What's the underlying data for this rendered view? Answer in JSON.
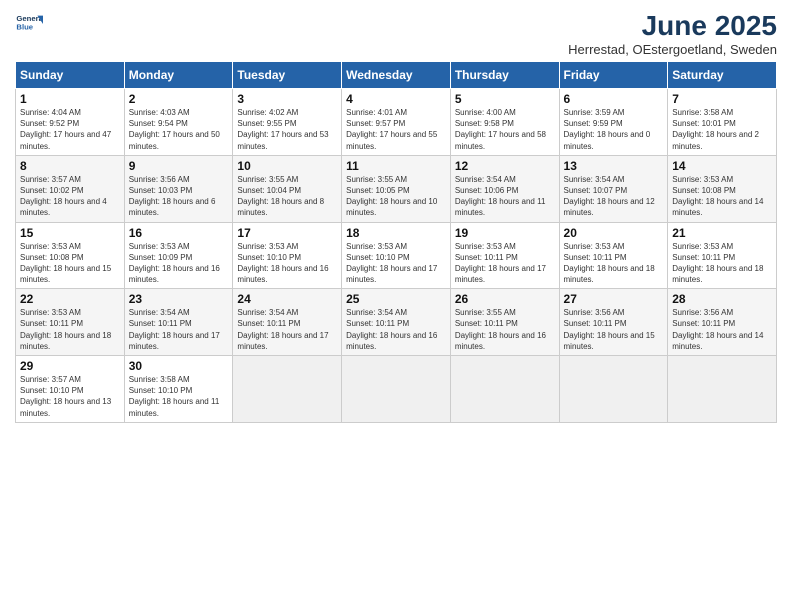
{
  "header": {
    "logo_line1": "General",
    "logo_line2": "Blue",
    "title": "June 2025",
    "subtitle": "Herrestad, OEstergoetland, Sweden"
  },
  "weekdays": [
    "Sunday",
    "Monday",
    "Tuesday",
    "Wednesday",
    "Thursday",
    "Friday",
    "Saturday"
  ],
  "weeks": [
    [
      {
        "day": "1",
        "sunrise": "Sunrise: 4:04 AM",
        "sunset": "Sunset: 9:52 PM",
        "daylight": "Daylight: 17 hours and 47 minutes."
      },
      {
        "day": "2",
        "sunrise": "Sunrise: 4:03 AM",
        "sunset": "Sunset: 9:54 PM",
        "daylight": "Daylight: 17 hours and 50 minutes."
      },
      {
        "day": "3",
        "sunrise": "Sunrise: 4:02 AM",
        "sunset": "Sunset: 9:55 PM",
        "daylight": "Daylight: 17 hours and 53 minutes."
      },
      {
        "day": "4",
        "sunrise": "Sunrise: 4:01 AM",
        "sunset": "Sunset: 9:57 PM",
        "daylight": "Daylight: 17 hours and 55 minutes."
      },
      {
        "day": "5",
        "sunrise": "Sunrise: 4:00 AM",
        "sunset": "Sunset: 9:58 PM",
        "daylight": "Daylight: 17 hours and 58 minutes."
      },
      {
        "day": "6",
        "sunrise": "Sunrise: 3:59 AM",
        "sunset": "Sunset: 9:59 PM",
        "daylight": "Daylight: 18 hours and 0 minutes."
      },
      {
        "day": "7",
        "sunrise": "Sunrise: 3:58 AM",
        "sunset": "Sunset: 10:01 PM",
        "daylight": "Daylight: 18 hours and 2 minutes."
      }
    ],
    [
      {
        "day": "8",
        "sunrise": "Sunrise: 3:57 AM",
        "sunset": "Sunset: 10:02 PM",
        "daylight": "Daylight: 18 hours and 4 minutes."
      },
      {
        "day": "9",
        "sunrise": "Sunrise: 3:56 AM",
        "sunset": "Sunset: 10:03 PM",
        "daylight": "Daylight: 18 hours and 6 minutes."
      },
      {
        "day": "10",
        "sunrise": "Sunrise: 3:55 AM",
        "sunset": "Sunset: 10:04 PM",
        "daylight": "Daylight: 18 hours and 8 minutes."
      },
      {
        "day": "11",
        "sunrise": "Sunrise: 3:55 AM",
        "sunset": "Sunset: 10:05 PM",
        "daylight": "Daylight: 18 hours and 10 minutes."
      },
      {
        "day": "12",
        "sunrise": "Sunrise: 3:54 AM",
        "sunset": "Sunset: 10:06 PM",
        "daylight": "Daylight: 18 hours and 11 minutes."
      },
      {
        "day": "13",
        "sunrise": "Sunrise: 3:54 AM",
        "sunset": "Sunset: 10:07 PM",
        "daylight": "Daylight: 18 hours and 12 minutes."
      },
      {
        "day": "14",
        "sunrise": "Sunrise: 3:53 AM",
        "sunset": "Sunset: 10:08 PM",
        "daylight": "Daylight: 18 hours and 14 minutes."
      }
    ],
    [
      {
        "day": "15",
        "sunrise": "Sunrise: 3:53 AM",
        "sunset": "Sunset: 10:08 PM",
        "daylight": "Daylight: 18 hours and 15 minutes."
      },
      {
        "day": "16",
        "sunrise": "Sunrise: 3:53 AM",
        "sunset": "Sunset: 10:09 PM",
        "daylight": "Daylight: 18 hours and 16 minutes."
      },
      {
        "day": "17",
        "sunrise": "Sunrise: 3:53 AM",
        "sunset": "Sunset: 10:10 PM",
        "daylight": "Daylight: 18 hours and 16 minutes."
      },
      {
        "day": "18",
        "sunrise": "Sunrise: 3:53 AM",
        "sunset": "Sunset: 10:10 PM",
        "daylight": "Daylight: 18 hours and 17 minutes."
      },
      {
        "day": "19",
        "sunrise": "Sunrise: 3:53 AM",
        "sunset": "Sunset: 10:11 PM",
        "daylight": "Daylight: 18 hours and 17 minutes."
      },
      {
        "day": "20",
        "sunrise": "Sunrise: 3:53 AM",
        "sunset": "Sunset: 10:11 PM",
        "daylight": "Daylight: 18 hours and 18 minutes."
      },
      {
        "day": "21",
        "sunrise": "Sunrise: 3:53 AM",
        "sunset": "Sunset: 10:11 PM",
        "daylight": "Daylight: 18 hours and 18 minutes."
      }
    ],
    [
      {
        "day": "22",
        "sunrise": "Sunrise: 3:53 AM",
        "sunset": "Sunset: 10:11 PM",
        "daylight": "Daylight: 18 hours and 18 minutes."
      },
      {
        "day": "23",
        "sunrise": "Sunrise: 3:54 AM",
        "sunset": "Sunset: 10:11 PM",
        "daylight": "Daylight: 18 hours and 17 minutes."
      },
      {
        "day": "24",
        "sunrise": "Sunrise: 3:54 AM",
        "sunset": "Sunset: 10:11 PM",
        "daylight": "Daylight: 18 hours and 17 minutes."
      },
      {
        "day": "25",
        "sunrise": "Sunrise: 3:54 AM",
        "sunset": "Sunset: 10:11 PM",
        "daylight": "Daylight: 18 hours and 16 minutes."
      },
      {
        "day": "26",
        "sunrise": "Sunrise: 3:55 AM",
        "sunset": "Sunset: 10:11 PM",
        "daylight": "Daylight: 18 hours and 16 minutes."
      },
      {
        "day": "27",
        "sunrise": "Sunrise: 3:56 AM",
        "sunset": "Sunset: 10:11 PM",
        "daylight": "Daylight: 18 hours and 15 minutes."
      },
      {
        "day": "28",
        "sunrise": "Sunrise: 3:56 AM",
        "sunset": "Sunset: 10:11 PM",
        "daylight": "Daylight: 18 hours and 14 minutes."
      }
    ],
    [
      {
        "day": "29",
        "sunrise": "Sunrise: 3:57 AM",
        "sunset": "Sunset: 10:10 PM",
        "daylight": "Daylight: 18 hours and 13 minutes."
      },
      {
        "day": "30",
        "sunrise": "Sunrise: 3:58 AM",
        "sunset": "Sunset: 10:10 PM",
        "daylight": "Daylight: 18 hours and 11 minutes."
      },
      null,
      null,
      null,
      null,
      null
    ]
  ]
}
